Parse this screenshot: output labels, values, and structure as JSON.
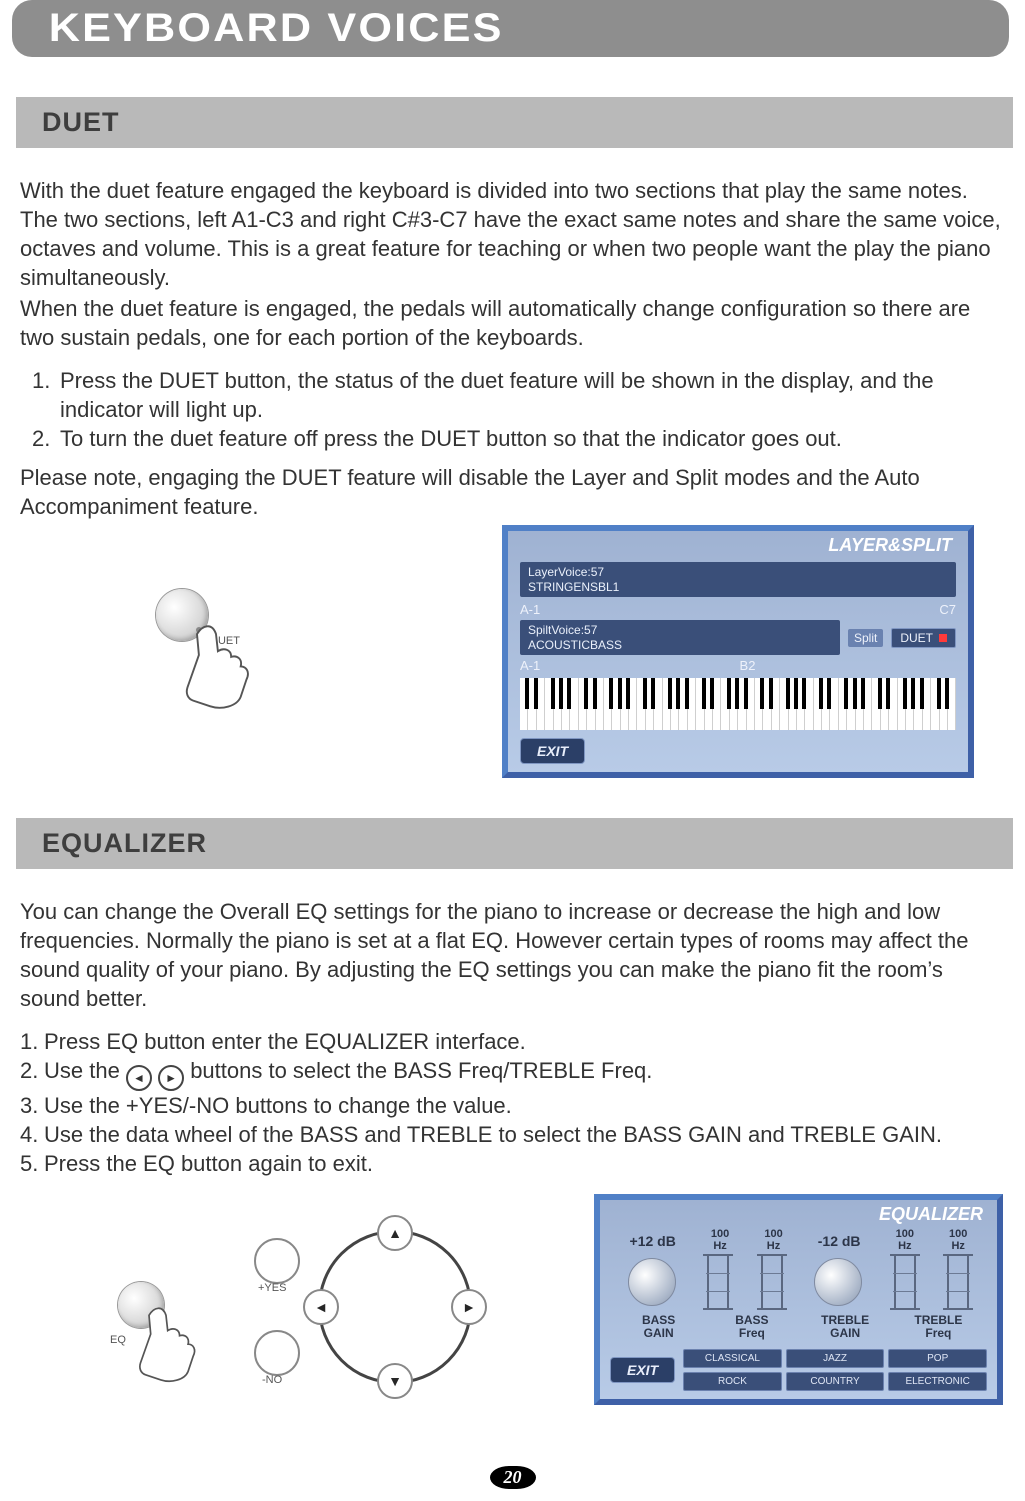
{
  "page_title": "KEYBOARD VOICES",
  "page_number": "20",
  "duet": {
    "heading": "DUET",
    "para1": "With the duet feature engaged the keyboard is divided into two sections that play the same notes. The two sections, left A1-C3 and right C#3-C7 have the exact same notes and share the same voice, octaves and volume. This is a great feature for teaching or when two people want the play the piano simultaneously.",
    "para2": "When the duet feature is engaged, the pedals will automatically change configuration so there are two sustain pedals, one for each portion of the keyboards.",
    "step1_num": "1.",
    "step1": "Press the DUET button, the status of the duet feature will be shown in the display, and the indicator will light up.",
    "step2_num": "2.",
    "step2": "To turn the duet feature off press the DUET button so that the indicator goes out.",
    "note": "Please note, engaging the DUET feature will disable the Layer and Split modes and the Auto Accompaniment feature.",
    "button_label": "DUET",
    "lcd": {
      "title": "LAYER&SPLIT",
      "layer_label": "LayerVoice:57",
      "layer_name": "STRINGENSBL1",
      "row1_left": "A-1",
      "row1_right": "C7",
      "split_label": "SpiltVoice:57",
      "split_name": "ACOUSTICBASS",
      "split_chip": "Split",
      "duet_chip": "DUET",
      "row2_left": "A-1",
      "row2_mid": "B2",
      "exit": "EXIT"
    }
  },
  "eq": {
    "heading": "EQUALIZER",
    "para": "You can change the Overall EQ settings for the piano to increase or decrease the high and low frequencies. Normally the piano is set at a flat EQ. However certain types of rooms may affect the sound quality of your piano. By adjusting the EQ settings you can make the piano fit the room’s sound better.",
    "step1_num": "1.",
    "step1": "Press EQ button enter the EQUALIZER interface.",
    "step2_num": "2.",
    "step2a": "Use the ",
    "step2b": " buttons to select the BASS Freq/TREBLE Freq.",
    "step3_num": "3.",
    "step3": "Use the +YES/-NO buttons to change the value.",
    "step4_num": "4.",
    "step4": "Use the data wheel of the BASS and TREBLE to select the BASS GAIN and TREBLE GAIN.",
    "step5_num": "5.",
    "step5": "Press the EQ button again to exit.",
    "button_label": "EQ",
    "yes_label": "+YES",
    "no_label": "-NO",
    "lcd": {
      "title": "EQUALIZER",
      "db1": "+12 dB",
      "db2": "-12 dB",
      "hz_top": "100",
      "hz_bot": "Hz",
      "lbl_bass_gain": "BASS GAIN",
      "lbl_bass_freq": "BASS Freq",
      "lbl_treble_gain": "TREBLE GAIN",
      "lbl_treble_freq": "TREBLE Freq",
      "exit": "EXIT",
      "presets": [
        "CLASSICAL",
        "JAZZ",
        "POP",
        "ROCK",
        "COUNTRY",
        "ELECTRONIC"
      ]
    }
  }
}
